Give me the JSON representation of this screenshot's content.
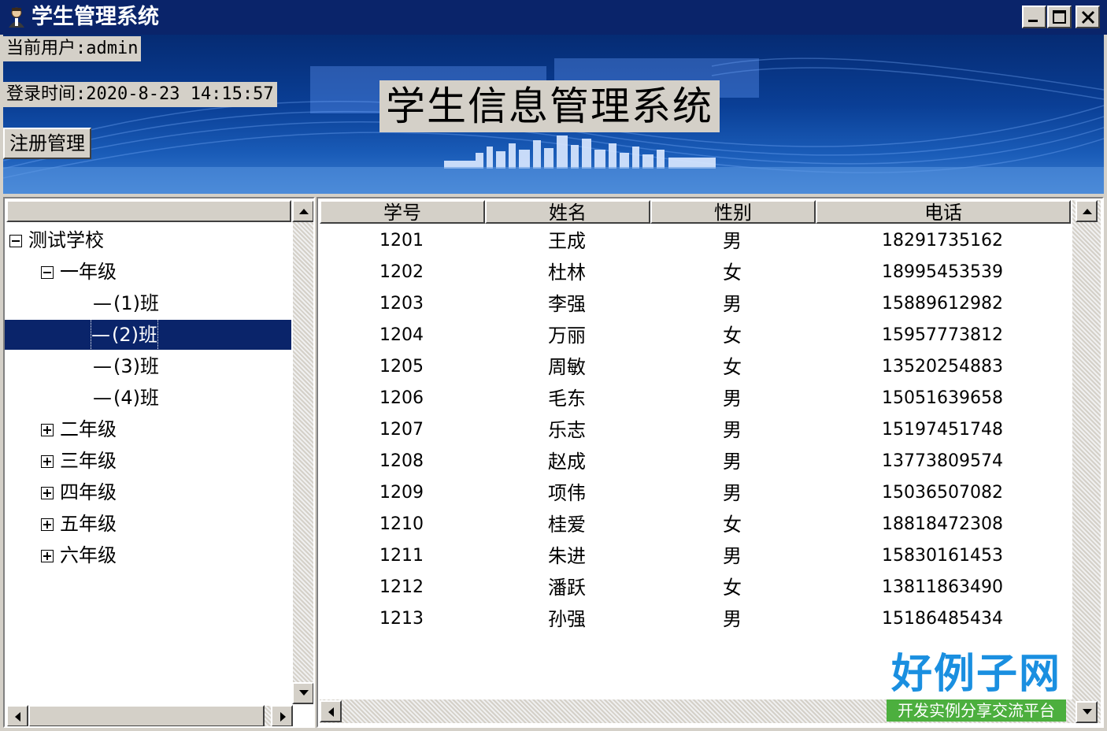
{
  "window": {
    "title": "学生管理系统",
    "icon": "user-icon"
  },
  "banner": {
    "current_user_label": "当前用户:admin",
    "login_time_label": "登录时间:2020-8-23 14:15:57",
    "register_button": "注册管理",
    "system_title": "学生信息管理系统"
  },
  "tree": {
    "root": "测试学校",
    "grade1": "一年级",
    "classes": [
      "(1)班",
      "(2)班",
      "(3)班",
      "(4)班"
    ],
    "selected_class": "(2)班",
    "grades": [
      "二年级",
      "三年级",
      "四年级",
      "五年级",
      "六年级"
    ]
  },
  "grid": {
    "columns": [
      "学号",
      "姓名",
      "性别",
      "电话"
    ],
    "rows": [
      [
        "1201",
        "王成",
        "男",
        "18291735162"
      ],
      [
        "1202",
        "杜林",
        "女",
        "18995453539"
      ],
      [
        "1203",
        "李强",
        "男",
        "15889612982"
      ],
      [
        "1204",
        "万丽",
        "女",
        "15957773812"
      ],
      [
        "1205",
        "周敏",
        "女",
        "13520254883"
      ],
      [
        "1206",
        "毛东",
        "男",
        "15051639658"
      ],
      [
        "1207",
        "乐志",
        "男",
        "15197451748"
      ],
      [
        "1208",
        "赵成",
        "男",
        "13773809574"
      ],
      [
        "1209",
        "项伟",
        "男",
        "15036507082"
      ],
      [
        "1210",
        "桂爱",
        "女",
        "18818472308"
      ],
      [
        "1211",
        "朱进",
        "男",
        "15830161453"
      ],
      [
        "1212",
        "潘跃",
        "女",
        "13811863490"
      ],
      [
        "1213",
        "孙强",
        "男",
        "15186485434"
      ]
    ]
  },
  "watermark": {
    "logo_main": "好例子网",
    "logo_sub": "开发实例分享交流平台"
  },
  "colors": {
    "titlebar": "#0a246a",
    "selection": "#0a246a",
    "face": "#d4d0c8"
  }
}
